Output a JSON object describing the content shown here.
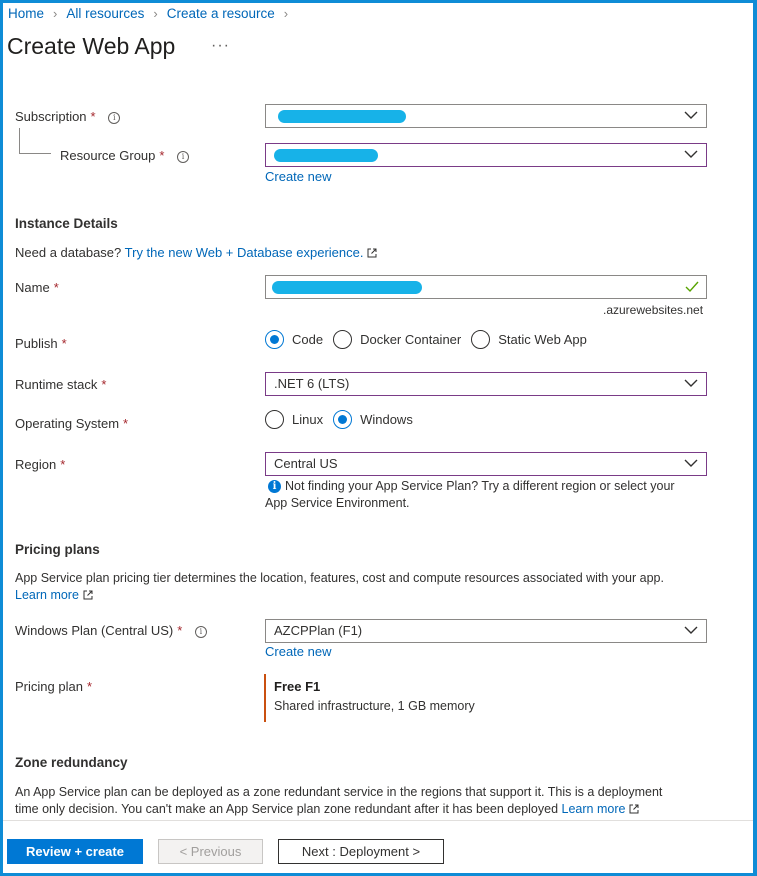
{
  "breadcrumb": [
    "Home",
    "All resources",
    "Create a resource"
  ],
  "page": {
    "title": "Create Web App",
    "more": "···"
  },
  "subscription": {
    "label": "Subscription",
    "required": "*",
    "value": ""
  },
  "resource_group": {
    "label": "Resource Group",
    "required": "*",
    "value": "",
    "create_new": "Create new"
  },
  "instance_details": {
    "title": "Instance Details",
    "db_prompt": "Need a database?",
    "db_link": "Try the new Web + Database experience."
  },
  "name": {
    "label": "Name",
    "required": "*",
    "value": "",
    "suffix": ".azurewebsites.net"
  },
  "publish": {
    "label": "Publish",
    "required": "*",
    "options": [
      "Code",
      "Docker Container",
      "Static Web App"
    ],
    "selected": "Code"
  },
  "runtime": {
    "label": "Runtime stack",
    "required": "*",
    "value": ".NET 6 (LTS)"
  },
  "os": {
    "label": "Operating System",
    "required": "*",
    "options": [
      "Linux",
      "Windows"
    ],
    "selected": "Windows"
  },
  "region": {
    "label": "Region",
    "required": "*",
    "value": "Central US",
    "hint_line1": "Not finding your App Service Plan? Try a different region or select your",
    "hint_line2": "App Service Environment."
  },
  "pricing_plans": {
    "title": "Pricing plans",
    "description": "App Service plan pricing tier determines the location, features, cost and compute resources associated with your app.",
    "learn_more": "Learn more"
  },
  "windows_plan": {
    "label": "Windows Plan (Central US)",
    "required": "*",
    "value": "AZCPPlan (F1)",
    "create_new": "Create new"
  },
  "pricing_plan": {
    "label": "Pricing plan",
    "required": "*",
    "tier": "Free F1",
    "details": "Shared infrastructure, 1 GB memory"
  },
  "zone_redundancy": {
    "title": "Zone redundancy",
    "line1": "An App Service plan can be deployed as a zone redundant service in the regions that support it. This is a deployment",
    "line2": "time only decision. You can't make an App Service plan zone redundant after it has been deployed",
    "learn_more": "Learn more"
  },
  "footer": {
    "review_create": "Review + create",
    "previous": "< Previous",
    "next": "Next : Deployment >"
  },
  "colors": {
    "accent": "#0078d4",
    "link": "#0067b8",
    "required": "#a4262c",
    "frame": "#0f8cd6",
    "success": "#57a300"
  }
}
